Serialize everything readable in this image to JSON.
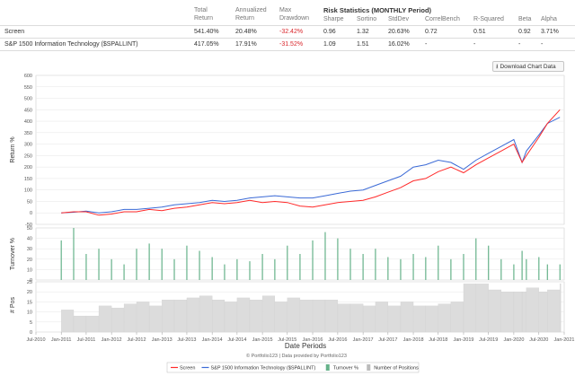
{
  "stats_table": {
    "headers": {
      "total_return": [
        "Total",
        "Return"
      ],
      "annualized_return": [
        "Annualized",
        "Return"
      ],
      "max_drawdown": [
        "Max",
        "Drawdown"
      ],
      "risk_title": "Risk Statistics (MONTHLY Period)",
      "sharpe": "Sharpe",
      "sortino": "Sortino",
      "stddev": "StdDev",
      "correl_bench": "CorrelBench",
      "r_squared": "R-Squared",
      "beta": "Beta",
      "alpha": "Alpha"
    },
    "rows": [
      {
        "name": "Screen",
        "total_return": "541.40%",
        "annualized_return": "20.48%",
        "max_drawdown": "-32.42%",
        "sharpe": "0.96",
        "sortino": "1.32",
        "stddev": "20.63%",
        "correl_bench": "0.72",
        "r_squared": "0.51",
        "beta": "0.92",
        "alpha": "3.71%"
      },
      {
        "name": "S&P 1500 Information Technology ($SPALLINT)",
        "total_return": "417.05%",
        "annualized_return": "17.91%",
        "max_drawdown": "-31.52%",
        "sharpe": "1.09",
        "sortino": "1.51",
        "stddev": "16.02%",
        "correl_bench": "-",
        "r_squared": "-",
        "beta": "-",
        "alpha": "-"
      }
    ]
  },
  "download_button": {
    "label": "Download Chart Data",
    "icon": "download-icon"
  },
  "chart_data": {
    "type": "line",
    "x_dates": [
      "2011-01-01",
      "2011-04-01",
      "2011-07-01",
      "2011-10-01",
      "2012-01-01",
      "2012-04-01",
      "2012-07-01",
      "2012-10-01",
      "2013-01-01",
      "2013-04-01",
      "2013-07-01",
      "2013-10-01",
      "2014-01-01",
      "2014-04-01",
      "2014-07-01",
      "2014-10-01",
      "2015-01-01",
      "2015-04-01",
      "2015-07-01",
      "2015-10-01",
      "2016-01-01",
      "2016-04-01",
      "2016-07-01",
      "2016-10-01",
      "2017-01-01",
      "2017-04-01",
      "2017-07-01",
      "2017-10-01",
      "2018-01-01",
      "2018-04-01",
      "2018-07-01",
      "2018-10-01",
      "2019-01-01",
      "2019-04-01",
      "2019-07-01",
      "2019-10-01",
      "2020-01-01",
      "2020-03-01",
      "2020-04-01",
      "2020-07-01",
      "2020-09-01",
      "2020-12-01"
    ],
    "series": [
      {
        "name": "Screen",
        "color": "#ff2a2a",
        "values": [
          0,
          5,
          5,
          -10,
          -5,
          5,
          5,
          15,
          10,
          20,
          25,
          35,
          45,
          40,
          45,
          55,
          45,
          50,
          45,
          30,
          25,
          35,
          45,
          50,
          55,
          70,
          90,
          110,
          140,
          150,
          180,
          200,
          175,
          210,
          240,
          270,
          300,
          220,
          250,
          330,
          390,
          450
        ]
      },
      {
        "name": "S&P 1500 Information Technology ($SPALLINT)",
        "color": "#3b6ad6",
        "values": [
          0,
          3,
          8,
          0,
          5,
          15,
          15,
          20,
          25,
          35,
          40,
          45,
          55,
          50,
          55,
          65,
          70,
          75,
          70,
          65,
          65,
          75,
          85,
          95,
          100,
          120,
          140,
          160,
          200,
          210,
          230,
          220,
          190,
          230,
          260,
          290,
          320,
          220,
          270,
          340,
          390,
          417
        ]
      }
    ],
    "return_axis": {
      "label": "Return %",
      "ylim": [
        -50,
        600
      ],
      "ticks": [
        -50,
        0,
        50,
        100,
        150,
        200,
        250,
        300,
        350,
        400,
        450,
        500,
        550,
        600
      ]
    },
    "turnover_axis": {
      "label": "Turnover %",
      "ylim": [
        0,
        50
      ],
      "ticks": [
        0,
        10,
        20,
        30,
        40,
        50
      ],
      "color": "#66b28a",
      "values": [
        38,
        50,
        25,
        30,
        20,
        15,
        30,
        35,
        30,
        20,
        33,
        28,
        22,
        15,
        20,
        18,
        25,
        20,
        33,
        25,
        38,
        46,
        40,
        30,
        25,
        30,
        22,
        20,
        25,
        22,
        33,
        20,
        25,
        40,
        33,
        20,
        15,
        28,
        20,
        22,
        15,
        15
      ]
    },
    "positions_axis": {
      "label": "# Pos",
      "ylim": [
        0,
        25
      ],
      "ticks": [
        0,
        5,
        10,
        15,
        20,
        25
      ],
      "color": "#dcdcdc",
      "values": [
        11,
        8,
        8,
        13,
        12,
        14,
        15,
        13,
        16,
        16,
        17,
        18,
        16,
        15,
        17,
        16,
        18,
        15,
        17,
        16,
        16,
        16,
        14,
        14,
        13,
        15,
        13,
        15,
        13,
        13,
        14,
        15,
        24,
        24,
        21,
        20,
        20,
        20,
        22,
        20,
        21,
        24
      ]
    },
    "x_axis": {
      "label": "Date Periods",
      "tick_labels": [
        "Jul-2010",
        "Jan-2011",
        "Jul-2011",
        "Jan-2012",
        "Jul-2012",
        "Jan-2013",
        "Jul-2013",
        "Jan-2014",
        "Jul-2014",
        "Jan-2015",
        "Jul-2015",
        "Jan-2016",
        "Jul-2016",
        "Jan-2017",
        "Jul-2017",
        "Jan-2018",
        "Jul-2018",
        "Jan-2019",
        "Jul-2019",
        "Jan-2020",
        "Jul-2020",
        "Jan-2021"
      ]
    },
    "legend": {
      "placement": "bottom",
      "items": [
        "Screen",
        "S&P 1500 Information Technology ($SPALLINT)",
        "Turnover %",
        "Number of Positions"
      ]
    },
    "credit": "© Portfolio123 | Data provided by Portfolio123",
    "grid": true
  }
}
